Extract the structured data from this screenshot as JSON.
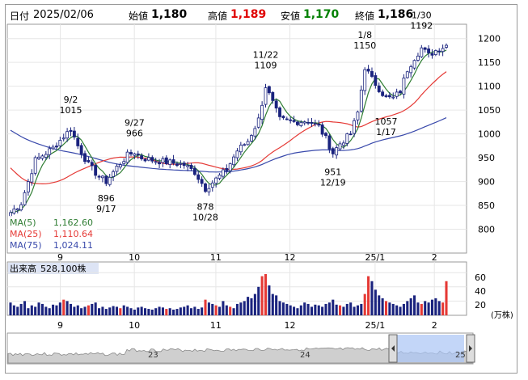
{
  "header": {
    "date_label": "日付",
    "date": "2025/02/06",
    "open_label": "始値",
    "open": "1,180",
    "high_label": "高値",
    "high": "1,189",
    "low_label": "安値",
    "low": "1,170",
    "close_label": "終値",
    "close": "1,186"
  },
  "legend": [
    {
      "label": "MA(5)",
      "value": "1,162.60",
      "color": "#2e7d32"
    },
    {
      "label": "MA(25)",
      "value": "1,110.64",
      "color": "#e53935"
    },
    {
      "label": "MA(75)",
      "value": "1,024.11",
      "color": "#3949ab"
    }
  ],
  "volume_panel": {
    "title": "出来高",
    "value": "528,100株",
    "unit": "(万株)",
    "ticks": [
      "20",
      "40",
      "60"
    ]
  },
  "navigator": {
    "year_labels": [
      "23",
      "24",
      "25"
    ]
  },
  "chart_data": {
    "type": "candlestick",
    "ylim": [
      750,
      1230
    ],
    "y_ticks": [
      800,
      850,
      900,
      950,
      1000,
      1050,
      1100,
      1150,
      1200
    ],
    "x_tick_labels": [
      "9",
      "10",
      "11",
      "12",
      "25/1",
      "2"
    ],
    "x_tick_positions": [
      13,
      33,
      55,
      75,
      98,
      114
    ],
    "candle_count": 124,
    "candle_color_up": "#ffffff",
    "candle_color_down": "#1a237e",
    "ma_colors": {
      "ma5": "#2e7d32",
      "ma25": "#e53935",
      "ma75": "#3949ab"
    },
    "annotations": [
      {
        "date": "9/2",
        "value": "1015",
        "index": 17,
        "position": "above"
      },
      {
        "date": "9/17",
        "value": "896",
        "index": 27,
        "position": "below"
      },
      {
        "date": "9/27",
        "value": "966",
        "index": 35,
        "position": "above"
      },
      {
        "date": "10/28",
        "value": "878",
        "index": 55,
        "position": "below"
      },
      {
        "date": "11/22",
        "value": "1109",
        "index": 72,
        "position": "above"
      },
      {
        "date": "12/19",
        "value": "951",
        "index": 91,
        "position": "below"
      },
      {
        "date": "1/8",
        "value": "1150",
        "index": 100,
        "position": "above"
      },
      {
        "date": "1/17",
        "value": "1057",
        "index": 106,
        "position": "below"
      },
      {
        "date": "1/30",
        "value": "1192",
        "index": 116,
        "position": "above"
      }
    ],
    "anchors": [
      [
        0,
        835
      ],
      [
        3,
        855
      ],
      [
        7,
        945
      ],
      [
        12,
        970
      ],
      [
        15,
        995
      ],
      [
        17,
        1010
      ],
      [
        19,
        975
      ],
      [
        22,
        935
      ],
      [
        25,
        910
      ],
      [
        27,
        900
      ],
      [
        30,
        930
      ],
      [
        33,
        955
      ],
      [
        35,
        962
      ],
      [
        37,
        950
      ],
      [
        40,
        945
      ],
      [
        45,
        940
      ],
      [
        49,
        935
      ],
      [
        52,
        920
      ],
      [
        55,
        885
      ],
      [
        58,
        905
      ],
      [
        61,
        925
      ],
      [
        64,
        965
      ],
      [
        67,
        985
      ],
      [
        70,
        1030
      ],
      [
        72,
        1100
      ],
      [
        74,
        1065
      ],
      [
        76,
        1030
      ],
      [
        80,
        1025
      ],
      [
        84,
        1028
      ],
      [
        87,
        1015
      ],
      [
        89,
        990
      ],
      [
        91,
        960
      ],
      [
        93,
        980
      ],
      [
        96,
        1000
      ],
      [
        98,
        1045
      ],
      [
        100,
        1140
      ],
      [
        102,
        1115
      ],
      [
        104,
        1095
      ],
      [
        106,
        1075
      ],
      [
        108,
        1075
      ],
      [
        110,
        1090
      ],
      [
        112,
        1135
      ],
      [
        114,
        1160
      ],
      [
        116,
        1180
      ],
      [
        118,
        1165
      ],
      [
        120,
        1175
      ],
      [
        123,
        1186
      ]
    ],
    "volume": {
      "ylim": [
        0,
        75
      ],
      "ticks": [
        20,
        40,
        60
      ],
      "bars": [
        18,
        14,
        12,
        16,
        20,
        10,
        14,
        12,
        18,
        16,
        12,
        10,
        15,
        14,
        18,
        22,
        20,
        16,
        12,
        14,
        10,
        12,
        14,
        16,
        18,
        10,
        12,
        9,
        11,
        13,
        12,
        10,
        14,
        12,
        10,
        8,
        11,
        12,
        10,
        9,
        8,
        10,
        12,
        11,
        9,
        10,
        8,
        9,
        11,
        12,
        14,
        10,
        12,
        9,
        11,
        22,
        18,
        16,
        14,
        12,
        20,
        14,
        12,
        10,
        16,
        18,
        20,
        26,
        24,
        30,
        40,
        55,
        58,
        42,
        30,
        28,
        20,
        18,
        16,
        14,
        12,
        10,
        14,
        18,
        16,
        12,
        15,
        14,
        12,
        16,
        18,
        22,
        15,
        14,
        12,
        16,
        18,
        12,
        14,
        16,
        30,
        55,
        48,
        36,
        28,
        24,
        20,
        18,
        16,
        14,
        12,
        16,
        20,
        24,
        28,
        18,
        16,
        20,
        18,
        22,
        24,
        20,
        18,
        48
      ],
      "red_indices": [
        15,
        22,
        31,
        44,
        55,
        58,
        62,
        71,
        72,
        93,
        100,
        101,
        106,
        116,
        122,
        123
      ]
    }
  }
}
